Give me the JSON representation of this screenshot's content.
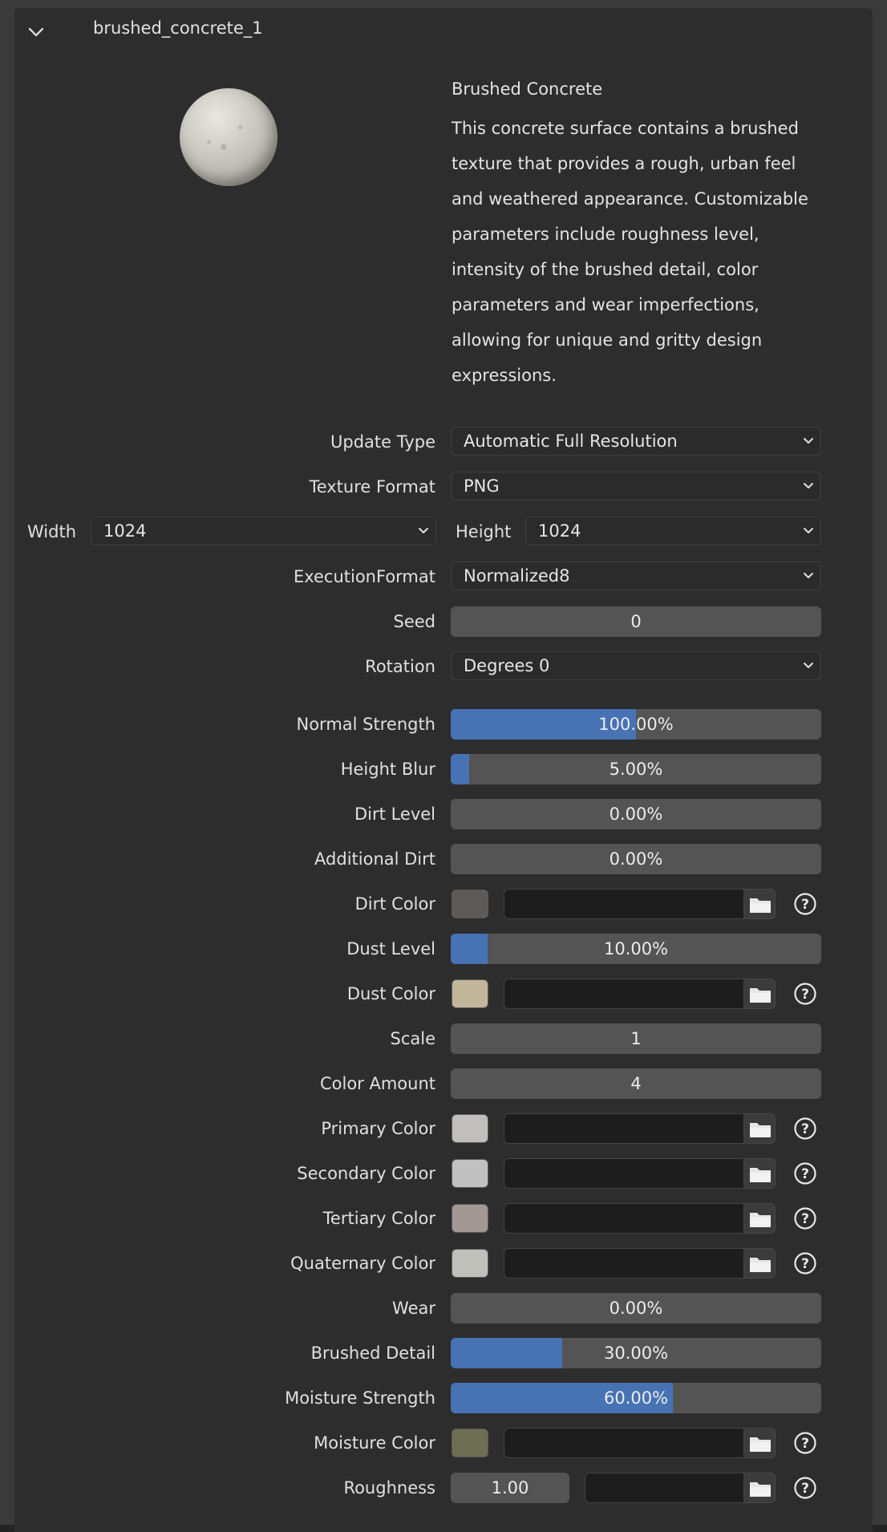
{
  "header": {
    "title": "brushed_concrete_1"
  },
  "description": {
    "title": "Brushed Concrete",
    "lines": [
      "This concrete surface contains a brushed",
      "texture that provides a rough, urban feel",
      "and weathered appearance. Customizable",
      "parameters include roughness level,",
      "intensity of the brushed detail, color",
      "parameters and wear imperfections,",
      "allowing for unique and gritty design",
      "expressions."
    ]
  },
  "settings": {
    "update_type": {
      "label": "Update Type",
      "value": "Automatic Full Resolution"
    },
    "texture_format": {
      "label": "Texture Format",
      "value": "PNG"
    },
    "width": {
      "label": "Width",
      "value": "1024"
    },
    "height": {
      "label": "Height",
      "value": "1024"
    },
    "execution_format": {
      "label": "ExecutionFormat",
      "value": "Normalized8"
    },
    "seed": {
      "label": "Seed",
      "value": "0"
    },
    "rotation": {
      "label": "Rotation",
      "value": "Degrees 0"
    }
  },
  "params": {
    "normal_strength": {
      "label": "Normal Strength",
      "value": "100.00%",
      "fraction": 0.5
    },
    "height_blur": {
      "label": "Height Blur",
      "value": "5.00%",
      "fraction": 0.05
    },
    "dirt_level": {
      "label": "Dirt Level",
      "value": "0.00%",
      "fraction": 0
    },
    "additional_dirt": {
      "label": "Additional Dirt",
      "value": "0.00%",
      "fraction": 0
    },
    "dirt_color": {
      "label": "Dirt Color",
      "color": "#5e5a58"
    },
    "dust_level": {
      "label": "Dust Level",
      "value": "10.00%",
      "fraction": 0.1
    },
    "dust_color": {
      "label": "Dust Color",
      "color": "#c2b69a"
    },
    "scale": {
      "label": "Scale",
      "value": "1"
    },
    "color_amount": {
      "label": "Color Amount",
      "value": "4"
    },
    "primary_color": {
      "label": "Primary Color",
      "color": "#c1bfbb"
    },
    "secondary_color": {
      "label": "Secondary Color",
      "color": "#c0c0c0"
    },
    "tertiary_color": {
      "label": "Tertiary Color",
      "color": "#a39893"
    },
    "quaternary_color": {
      "label": "Quaternary Color",
      "color": "#c0c0bb"
    },
    "wear": {
      "label": "Wear",
      "value": "0.00%",
      "fraction": 0
    },
    "brushed_detail": {
      "label": "Brushed Detail",
      "value": "30.00%",
      "fraction": 0.3
    },
    "moisture_strength": {
      "label": "Moisture Strength",
      "value": "60.00%",
      "fraction": 0.6
    },
    "moisture_color": {
      "label": "Moisture Color",
      "color": "#6e6e54"
    },
    "roughness": {
      "label": "Roughness",
      "value": "1.00"
    }
  },
  "icons": {
    "collapse": "chevron-down-icon",
    "dropdown": "chevron-down-icon",
    "folder": "folder-icon",
    "help": "question-circle-icon"
  },
  "colors": {
    "accent": "#4772b3"
  }
}
